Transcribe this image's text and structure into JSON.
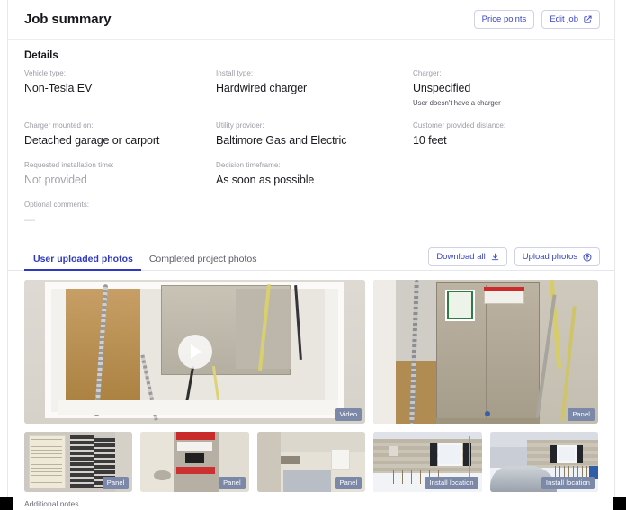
{
  "header": {
    "title": "Job summary",
    "buttons": [
      {
        "label": "Price points",
        "icon": "none"
      },
      {
        "label": "Edit job",
        "icon": "edit-external-icon"
      }
    ]
  },
  "details": {
    "section_title": "Details",
    "fields": [
      {
        "label": "Vehicle type:",
        "value": "Non-Tesla EV",
        "style": "normal",
        "sub": ""
      },
      {
        "label": "Install type:",
        "value": "Hardwired charger",
        "style": "normal",
        "sub": ""
      },
      {
        "label": "Charger:",
        "value": "Unspecified",
        "style": "normal",
        "sub": "User doesn't have a charger"
      },
      {
        "label": "Charger mounted on:",
        "value": "Detached garage or carport",
        "style": "normal",
        "sub": ""
      },
      {
        "label": "Utility provider:",
        "value": "Baltimore Gas and Electric",
        "style": "normal",
        "sub": ""
      },
      {
        "label": "Customer provided distance:",
        "value": "10 feet",
        "style": "normal",
        "sub": ""
      },
      {
        "label": "Requested installation time:",
        "value": "Not provided",
        "style": "muted",
        "sub": ""
      },
      {
        "label": "Decision timeframe:",
        "value": "As soon as possible",
        "style": "normal",
        "sub": ""
      },
      {
        "label": "",
        "value": "",
        "style": "empty",
        "sub": ""
      },
      {
        "label": "Optional comments:",
        "value": "—",
        "style": "dash",
        "sub": ""
      }
    ]
  },
  "photos_panel": {
    "tabs": [
      {
        "label": "User uploaded photos",
        "active": true
      },
      {
        "label": "Completed project photos",
        "active": false
      }
    ],
    "actions": [
      {
        "label": "Download all",
        "icon": "download-icon"
      },
      {
        "label": "Upload photos",
        "icon": "upload-icon"
      }
    ],
    "hero": [
      {
        "badge": "Video",
        "is_video": true,
        "art": "p1"
      },
      {
        "badge": "Panel",
        "is_video": false,
        "art": "p2"
      }
    ],
    "thumbnails": [
      {
        "badge": "Panel",
        "art": "t1"
      },
      {
        "badge": "Panel",
        "art": "t2"
      },
      {
        "badge": "Panel",
        "art": "t3"
      },
      {
        "badge": "Install location",
        "art": "t4"
      },
      {
        "badge": "Install location",
        "art": "t5"
      }
    ]
  },
  "footer": {
    "additional_notes_label": "Additional notes"
  },
  "colors": {
    "accent": "#2f39c0",
    "button_text": "#3b46c4",
    "badge_bg": "#7b88a8",
    "label_gray": "#9b9ba6",
    "border": "#e8e8ec"
  }
}
